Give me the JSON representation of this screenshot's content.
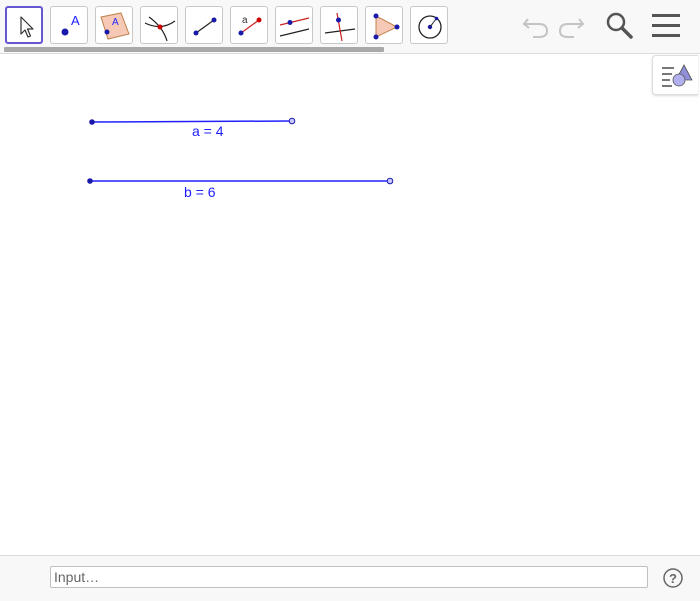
{
  "toolbar": {
    "tools": [
      {
        "name": "move-tool",
        "icon": "arrow-pointer-icon",
        "selected": true
      },
      {
        "name": "point-tool",
        "icon": "point-icon",
        "label": "A"
      },
      {
        "name": "polygon-point-tool",
        "icon": "point-on-object-icon",
        "label": "A"
      },
      {
        "name": "intersect-tool",
        "icon": "intersect-icon"
      },
      {
        "name": "segment-tool",
        "icon": "segment-icon"
      },
      {
        "name": "segment-length-tool",
        "icon": "segment-fixed-length-icon",
        "label": "a"
      },
      {
        "name": "parallel-line-tool",
        "icon": "parallel-line-icon"
      },
      {
        "name": "perpendicular-line-tool",
        "icon": "perpendicular-line-icon"
      },
      {
        "name": "polygon-tool",
        "icon": "polygon-icon"
      },
      {
        "name": "circle-tool",
        "icon": "circle-center-point-icon"
      }
    ],
    "actions": [
      {
        "name": "undo-button",
        "icon": "undo-icon"
      },
      {
        "name": "redo-button",
        "icon": "redo-icon"
      },
      {
        "name": "search-button",
        "icon": "search-icon"
      },
      {
        "name": "menu-button",
        "icon": "hamburger-menu-icon"
      }
    ]
  },
  "graphics": {
    "objects": [
      {
        "name": "segment-a",
        "label": "a = 4"
      },
      {
        "name": "segment-b",
        "label": "b = 6"
      }
    ]
  },
  "input_bar": {
    "placeholder": "Input…",
    "help_icon": "help-icon"
  },
  "colors": {
    "object_blue": "#2020ff",
    "point_fill": "#1a1aaa",
    "selected_tool_border": "#6557d2"
  }
}
